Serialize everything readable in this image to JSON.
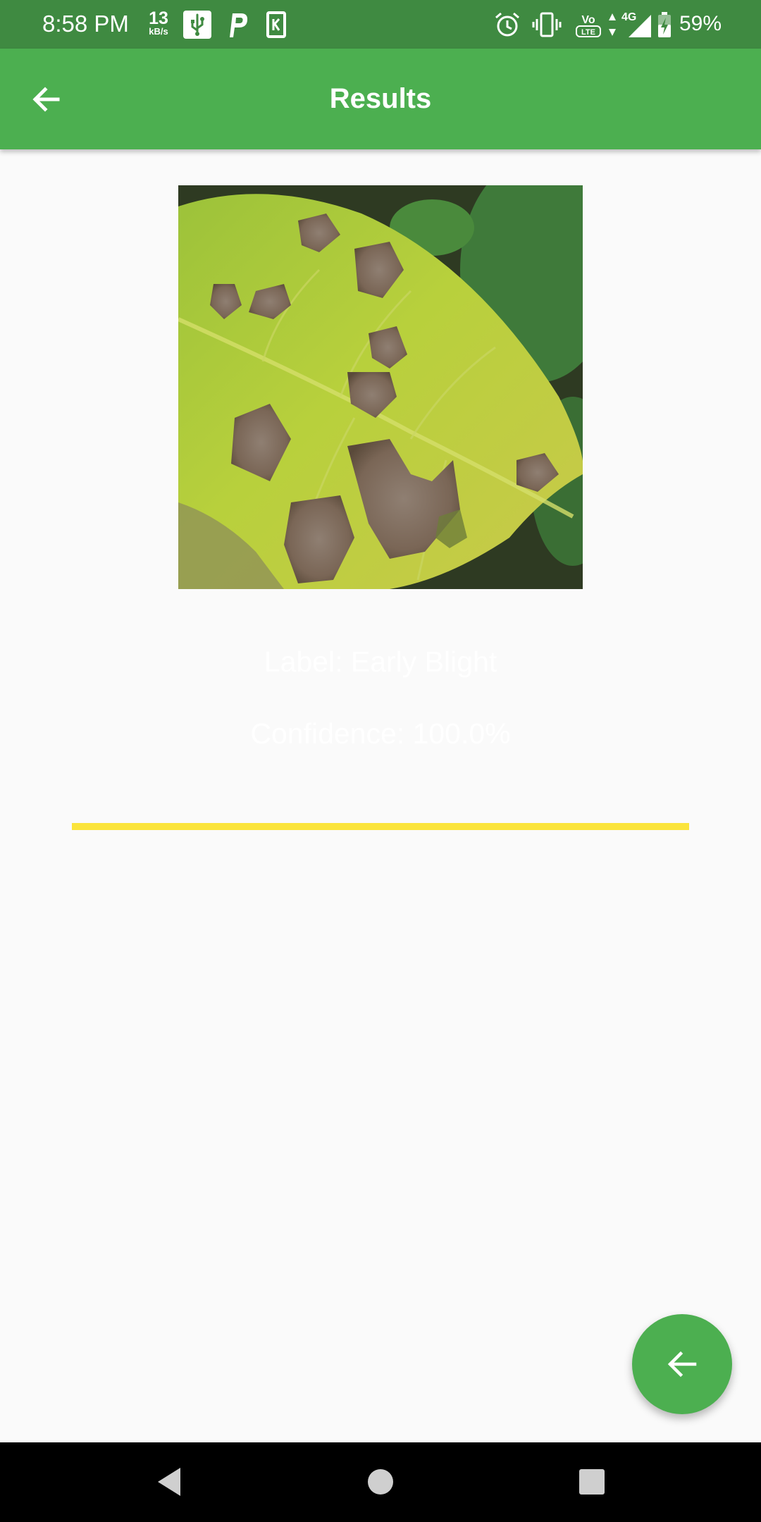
{
  "status_bar": {
    "time": "8:58 PM",
    "net_speed_value": "13",
    "net_speed_unit": "kB/s",
    "network_label": "4G",
    "volte_label": "VoLTE",
    "battery_percent": "59%",
    "icons": [
      "usb-icon",
      "p-app-icon",
      "k-app-icon",
      "alarm-icon",
      "vibrate-icon",
      "volte-icon",
      "data-arrows-icon",
      "signal-icon",
      "battery-charging-icon"
    ]
  },
  "app_bar": {
    "title": "Results",
    "back_icon": "arrow-back-icon"
  },
  "result": {
    "label_text": "Label: Early Blight",
    "confidence_text": "Confidence: 100.0%",
    "confidence_progress": 1.0
  },
  "fab": {
    "icon": "arrow-back-icon"
  },
  "nav_bar": {
    "buttons": [
      "back-triangle-icon",
      "home-circle-icon",
      "recents-square-icon"
    ]
  },
  "colors": {
    "status_bar": "#3f8a41",
    "app_bar": "#4caf50",
    "background": "#fafafa",
    "progress_fill": "#fbe43c",
    "fab": "#4caf50",
    "nav_bar": "#000000"
  }
}
